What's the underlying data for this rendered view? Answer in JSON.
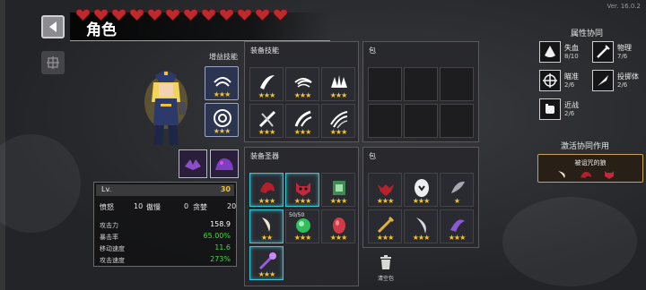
{
  "header": {
    "title": "角色",
    "hearts_full": 12,
    "version": "Ver. 16.0.2"
  },
  "character": {
    "skill_heading": "增益技能",
    "buff_skills": [
      {
        "icon": "double-arc-icon",
        "stars": "★★★"
      },
      {
        "icon": "target-circle-icon",
        "stars": "★★★"
      }
    ],
    "pets": [
      "purple-bat-icon",
      "purple-beast-icon"
    ]
  },
  "stats": {
    "level_label": "Lv.",
    "level": "30",
    "vices": [
      {
        "label": "愤怒",
        "value": "10"
      },
      {
        "label": "傲慢",
        "value": "0"
      },
      {
        "label": "贪婪",
        "value": "20"
      }
    ],
    "attributes": [
      {
        "label": "攻击力",
        "value": "158.9",
        "color": "#ffffff"
      },
      {
        "label": "暴击率",
        "value": "65.00%",
        "color": "#3ddc3d"
      },
      {
        "label": "移动速度",
        "value": "11.6",
        "color": "#3ddc3d"
      },
      {
        "label": "攻击速度",
        "value": "273%",
        "color": "#3ddc3d"
      }
    ]
  },
  "equip_skills": {
    "title": "装备技能",
    "slots": [
      {
        "icon": "slash-white-icon",
        "stars": "★★★"
      },
      {
        "icon": "swirl-wind-icon",
        "stars": "★★★"
      },
      {
        "icon": "spike-burst-icon",
        "stars": "★★★"
      },
      {
        "icon": "cross-slash-icon",
        "stars": "★★★"
      },
      {
        "icon": "dual-slash-icon",
        "stars": "★★★"
      },
      {
        "icon": "triple-slash-icon",
        "stars": "★★★"
      }
    ]
  },
  "skill_bag": {
    "title": "包"
  },
  "equip_relics": {
    "title": "装备圣器",
    "stack_count": "50/50",
    "slots": [
      {
        "icon": "red-claw-icon",
        "stars": "★★★"
      },
      {
        "icon": "demon-mask-icon",
        "stars": "★★★"
      },
      {
        "icon": "green-tome-icon",
        "stars": "★★★"
      },
      {
        "icon": "fang-icon",
        "stars": "★★"
      },
      {
        "icon": "green-orb-icon",
        "stars": "★★★"
      },
      {
        "icon": "red-egg-icon",
        "stars": "★★★"
      },
      {
        "icon": "purple-wand-icon",
        "stars": "★★★"
      }
    ]
  },
  "relic_bag": {
    "title": "包",
    "slots": [
      {
        "icon": "red-heart-bat-icon",
        "stars": "★★★"
      },
      {
        "icon": "ghost-egg-icon",
        "stars": "★★★"
      },
      {
        "icon": "stone-feather-icon",
        "stars": "★"
      },
      {
        "icon": "golden-sword-icon",
        "stars": "★★★"
      },
      {
        "icon": "curved-blade-icon",
        "stars": "★★★"
      },
      {
        "icon": "purple-talon-icon",
        "stars": "★★★"
      }
    ],
    "trash_label": "清空包"
  },
  "synergy": {
    "title": "属性协同",
    "items": [
      {
        "name": "失血",
        "count": "8/10",
        "icon": "blood-drop-icon"
      },
      {
        "name": "物理",
        "count": "7/6",
        "icon": "sword-icon"
      },
      {
        "name": "瞄准",
        "count": "2/6",
        "icon": "crosshair-icon"
      },
      {
        "name": "投掷体",
        "count": "2/6",
        "icon": "projectile-icon"
      },
      {
        "name": "近战",
        "count": "2/6",
        "icon": "fist-icon"
      }
    ],
    "activate_title": "激活协同作用",
    "active_set": "被诅咒的狼"
  },
  "colors": {
    "gold": "#c9a24a",
    "star": "#f4c431",
    "cyan": "#39c7d8",
    "green": "#3ddc3d",
    "heart": "#c0282b"
  }
}
